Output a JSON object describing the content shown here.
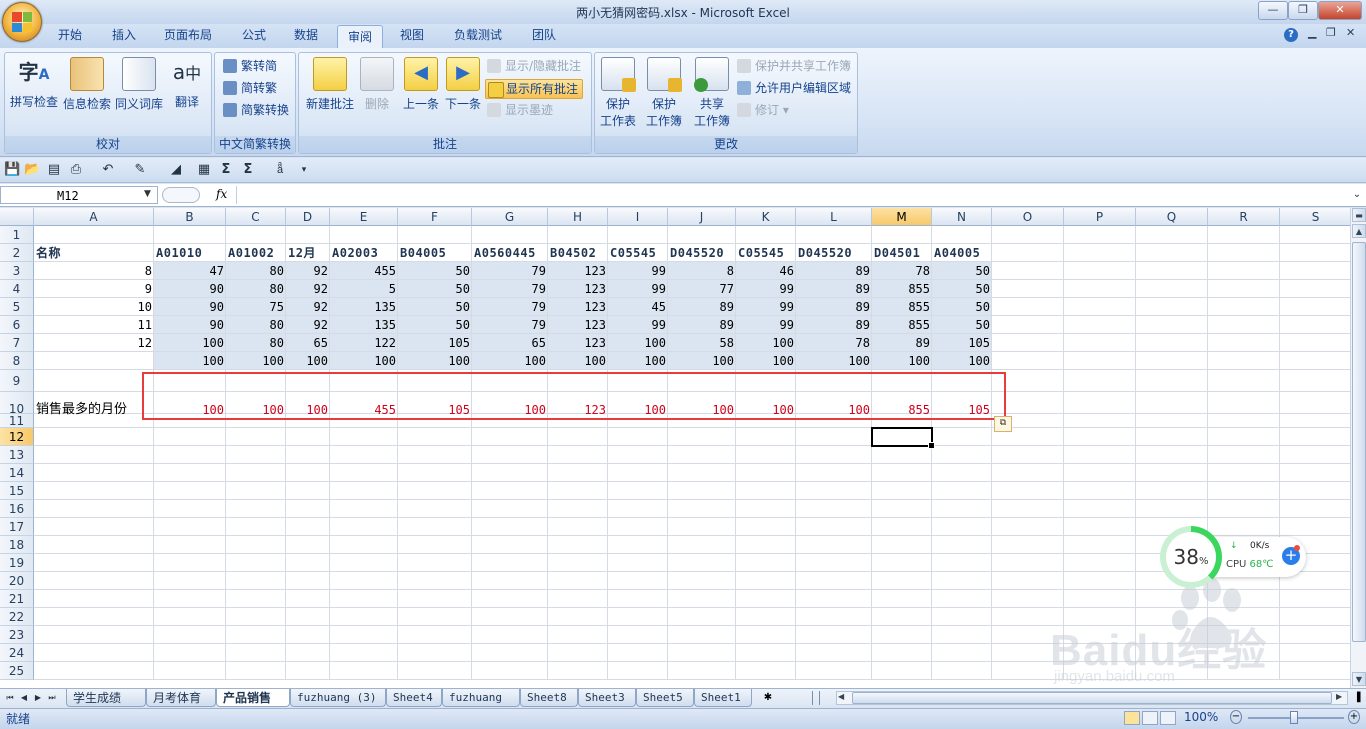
{
  "window": {
    "title": "两小无猜网密码.xlsx - Microsoft Excel",
    "minimize": "—",
    "maximize": "❐",
    "close": "✕",
    "help": "?"
  },
  "tabs": [
    "开始",
    "插入",
    "页面布局",
    "公式",
    "数据",
    "审阅",
    "视图",
    "负载测试",
    "团队"
  ],
  "active_tab": "审阅",
  "ribbon": {
    "group_proofing": {
      "label": "校对",
      "spell": "拼写检查",
      "research": "信息检索",
      "thesaurus": "同义词库",
      "translate": "翻译"
    },
    "group_chinese": {
      "label": "中文简繁转换",
      "to_simplified": "繁转简",
      "to_traditional": "简转繁",
      "convert": "简繁转换"
    },
    "group_comments": {
      "label": "批注",
      "new": "新建批注",
      "delete": "删除",
      "prev": "上一条",
      "next": "下一条",
      "show_hide": "显示/隐藏批注",
      "show_all": "显示所有批注",
      "show_ink": "显示墨迹"
    },
    "group_changes": {
      "label": "更改",
      "protect_sheet_1": "保护",
      "protect_sheet_2": "工作表",
      "protect_wb_1": "保护",
      "protect_wb_2": "工作簿",
      "share_1": "共享",
      "share_2": "工作簿",
      "protect_share": "保护并共享工作簿",
      "allow_edit": "允许用户编辑区域",
      "track": "修订"
    }
  },
  "formula_bar": {
    "name_box": "M12",
    "fx": "fx",
    "value": ""
  },
  "sheet": {
    "columns": [
      "A",
      "B",
      "C",
      "D",
      "E",
      "F",
      "G",
      "H",
      "I",
      "J",
      "K",
      "L",
      "M",
      "N",
      "O",
      "P",
      "Q",
      "R",
      "S"
    ],
    "selected_column": "M",
    "selected_row": "12",
    "rows": [
      "1",
      "2",
      "3",
      "4",
      "5",
      "6",
      "7",
      "8",
      "9",
      "10",
      "11",
      "12",
      "13",
      "14",
      "15",
      "16",
      "17",
      "18",
      "19",
      "20",
      "21",
      "22",
      "23",
      "24",
      "25"
    ],
    "header_row": {
      "A": "名称",
      "values": [
        "A01010",
        "A01002",
        "12月",
        "A02003",
        "B04005",
        "A0560445",
        "B04502",
        "C05545",
        "D045520",
        "C05545",
        "D045520",
        "D04501",
        "A04005"
      ]
    },
    "data_rows": [
      {
        "A": "8",
        "values": [
          "47",
          "80",
          "92",
          "455",
          "50",
          "79",
          "123",
          "99",
          "8",
          "46",
          "89",
          "78",
          "50"
        ]
      },
      {
        "A": "9",
        "values": [
          "90",
          "80",
          "92",
          "5",
          "50",
          "79",
          "123",
          "99",
          "77",
          "99",
          "89",
          "855",
          "50"
        ]
      },
      {
        "A": "10",
        "values": [
          "90",
          "75",
          "92",
          "135",
          "50",
          "79",
          "123",
          "45",
          "89",
          "99",
          "89",
          "855",
          "50"
        ]
      },
      {
        "A": "11",
        "values": [
          "90",
          "80",
          "92",
          "135",
          "50",
          "79",
          "123",
          "99",
          "89",
          "99",
          "89",
          "855",
          "50"
        ]
      },
      {
        "A": "12",
        "values": [
          "100",
          "80",
          "65",
          "122",
          "105",
          "65",
          "123",
          "100",
          "58",
          "100",
          "78",
          "89",
          "105"
        ]
      },
      {
        "A": "",
        "values": [
          "100",
          "100",
          "100",
          "100",
          "100",
          "100",
          "100",
          "100",
          "100",
          "100",
          "100",
          "100",
          "100"
        ]
      }
    ],
    "result_row": {
      "A": "销售最多的月份",
      "values": [
        "100",
        "100",
        "100",
        "455",
        "105",
        "100",
        "123",
        "100",
        "100",
        "100",
        "100",
        "855",
        "105"
      ]
    }
  },
  "sheet_tabs": [
    "学生成绩",
    "月考体育",
    "产品销售",
    "fuzhuang (3)",
    "Sheet4",
    "fuzhuang",
    "Sheet8",
    "Sheet3",
    "Sheet5",
    "Sheet1"
  ],
  "active_sheet": "产品销售",
  "status": {
    "ready": "就绪",
    "zoom": "100%"
  },
  "cpu_widget": {
    "percent": "38",
    "percent_unit": "%",
    "speed": "0K/s",
    "temp_label": "CPU",
    "temp_value": "68℃"
  },
  "watermark": {
    "text": "Baidu经验",
    "url": "jingyan.baidu.com"
  },
  "colors": {
    "accent": "#15428b",
    "result_text": "#d0021b",
    "highlight_box": "#e83b3b",
    "data_shade": "#dbe5f1"
  }
}
